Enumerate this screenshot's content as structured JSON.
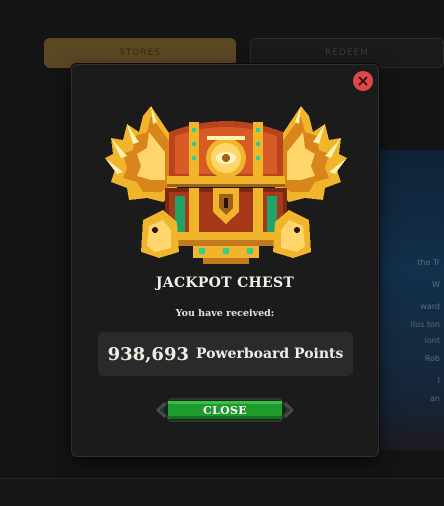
{
  "background": {
    "tab_left": "STORES",
    "tab_right": "REDEEM",
    "panel_lines": [
      "the Tr",
      "W",
      "ward",
      "ilus ton",
      "iont",
      "Rob",
      "l",
      "an"
    ]
  },
  "modal": {
    "title": "JACKPOT CHEST",
    "subtitle": "You have received:",
    "reward_amount": "938,693",
    "reward_unit": "Powerboard Points",
    "close_button_label": "CLOSE",
    "icons": {
      "dismiss": "close-x-icon",
      "chest": "jackpot-chest-icon"
    },
    "colors": {
      "dismiss_red": "#e04848",
      "button_green": "#1f9a2c",
      "gold": "#f0b52a"
    }
  }
}
